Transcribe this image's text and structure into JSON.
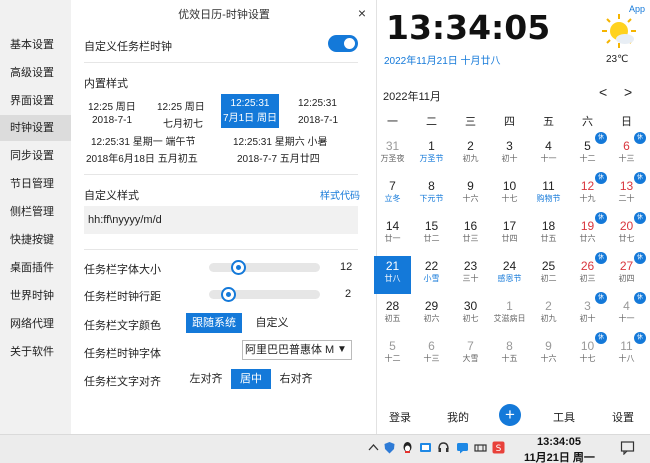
{
  "window": {
    "title": "优效日历-时钟设置",
    "close": "×"
  },
  "sidebar": {
    "items": [
      {
        "label": "基本设置"
      },
      {
        "label": "高级设置"
      },
      {
        "label": "界面设置"
      },
      {
        "label": "时钟设置"
      },
      {
        "label": "同步设置"
      },
      {
        "label": "节日管理"
      },
      {
        "label": "侧栏管理"
      },
      {
        "label": "快捷按键"
      },
      {
        "label": "桌面插件"
      },
      {
        "label": "世界时钟"
      },
      {
        "label": "网络代理"
      },
      {
        "label": "关于软件"
      }
    ],
    "active": "时钟设置"
  },
  "custom_clock": {
    "label": "自定义任务栏时钟",
    "enabled": true
  },
  "builtin": {
    "label": "内置样式",
    "styles": [
      "12:25 周日",
      "12:25 周日",
      "12:25:31",
      "12:25:31",
      "2018-7-1",
      "七月初七",
      "7月1日 周日",
      "2018-7-1",
      "12:25:31 星期一 端午节",
      "12:25:31 星期六 小暑",
      "2018年6月18日 五月初五",
      "2018-7-7 五月廿四"
    ],
    "selected_line1": "12:25:31",
    "selected_line2": "7月1日 周日"
  },
  "custom_style": {
    "label": "自定义样式",
    "link": "样式代码",
    "value": "hh:ff\\nyyyy/m/d"
  },
  "font_size": {
    "label": "任务栏字体大小",
    "value": "12",
    "level": 0.25
  },
  "line_spacing": {
    "label": "任务栏时钟行距",
    "value": "2",
    "level": 0.15
  },
  "text_color": {
    "label": "任务栏文字颜色",
    "options": [
      "跟随系统",
      "自定义"
    ],
    "selected": "跟随系统"
  },
  "clock_font": {
    "label": "任务栏时钟字体",
    "value": "阿里巴巴普惠体 M",
    "arrow": "▼"
  },
  "text_align": {
    "label": "任务栏文字对齐",
    "options": [
      "左对齐",
      "居中",
      "右对齐"
    ],
    "selected": "居中"
  },
  "calendar": {
    "time": "13:34:05",
    "app_tag": "App",
    "date_line": "2022年11月21日  十月廿八",
    "temperature": "23℃",
    "month": "2022年11月",
    "prev": "<",
    "next": ">",
    "weekdays": [
      "一",
      "二",
      "三",
      "四",
      "五",
      "六",
      "日"
    ],
    "days": [
      {
        "d": "31",
        "s": "万圣夜",
        "dim": true
      },
      {
        "d": "1",
        "s": "万圣节",
        "blue": true
      },
      {
        "d": "2",
        "s": "初九"
      },
      {
        "d": "3",
        "s": "初十"
      },
      {
        "d": "4",
        "s": "十一"
      },
      {
        "d": "5",
        "s": "十二",
        "badge": "休"
      },
      {
        "d": "6",
        "s": "十三",
        "red": true,
        "badge": "休"
      },
      {
        "d": "7",
        "s": "立冬",
        "blue": true
      },
      {
        "d": "8",
        "s": "下元节",
        "blue": true
      },
      {
        "d": "9",
        "s": "十六"
      },
      {
        "d": "10",
        "s": "十七"
      },
      {
        "d": "11",
        "s": "购物节",
        "blue": true
      },
      {
        "d": "12",
        "s": "十九",
        "red": true,
        "badge": "休"
      },
      {
        "d": "13",
        "s": "二十",
        "red": true,
        "badge": "休"
      },
      {
        "d": "14",
        "s": "廿一"
      },
      {
        "d": "15",
        "s": "廿二"
      },
      {
        "d": "16",
        "s": "廿三"
      },
      {
        "d": "17",
        "s": "廿四"
      },
      {
        "d": "18",
        "s": "廿五"
      },
      {
        "d": "19",
        "s": "廿六",
        "red": true,
        "badge": "休"
      },
      {
        "d": "20",
        "s": "廿七",
        "red": true,
        "badge": "休"
      },
      {
        "d": "21",
        "s": "廿八",
        "today": true
      },
      {
        "d": "22",
        "s": "小雪",
        "blue": true
      },
      {
        "d": "23",
        "s": "三十"
      },
      {
        "d": "24",
        "s": "感恩节",
        "blue": true
      },
      {
        "d": "25",
        "s": "初二"
      },
      {
        "d": "26",
        "s": "初三",
        "red": true,
        "badge": "休"
      },
      {
        "d": "27",
        "s": "初四",
        "red": true,
        "badge": "休"
      },
      {
        "d": "28",
        "s": "初五"
      },
      {
        "d": "29",
        "s": "初六"
      },
      {
        "d": "30",
        "s": "初七"
      },
      {
        "d": "1",
        "s": "艾滋病日",
        "dim": true
      },
      {
        "d": "2",
        "s": "初九",
        "dim": true
      },
      {
        "d": "3",
        "s": "初十",
        "dim": true,
        "badge": "休"
      },
      {
        "d": "4",
        "s": "十一",
        "dim": true,
        "badge": "休"
      },
      {
        "d": "5",
        "s": "十二",
        "dim": true
      },
      {
        "d": "6",
        "s": "十三",
        "dim": true
      },
      {
        "d": "7",
        "s": "大雪",
        "dim": true
      },
      {
        "d": "8",
        "s": "十五",
        "dim": true
      },
      {
        "d": "9",
        "s": "十六",
        "dim": true
      },
      {
        "d": "10",
        "s": "十七",
        "dim": true,
        "badge": "休"
      },
      {
        "d": "11",
        "s": "十八",
        "dim": true,
        "badge": "休"
      }
    ],
    "bottom": [
      "登录",
      "我的",
      "+",
      "工具",
      "设置"
    ]
  },
  "taskbar": {
    "time": "13:34:05",
    "date": "11月21日 周一"
  },
  "colors": {
    "accent": "#1479d9",
    "holiday_red": "#d9363e"
  }
}
